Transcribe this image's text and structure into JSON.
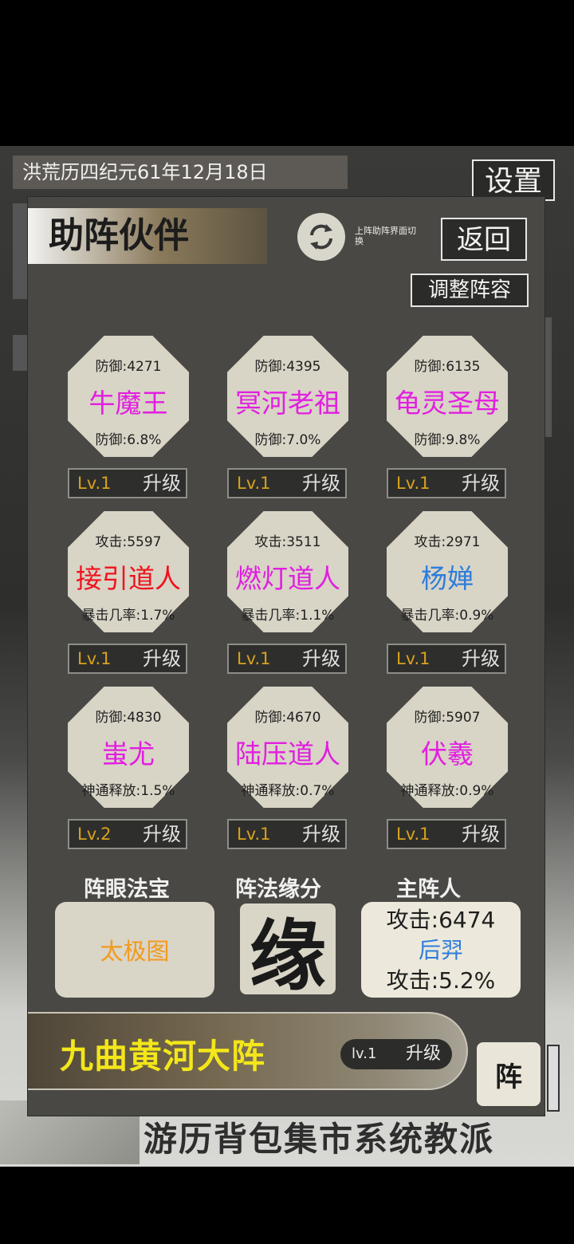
{
  "background": {
    "date": "洪荒历四纪元61年12月18日",
    "settings_label": "设置",
    "nav": "游历背包集市系统教派"
  },
  "panel": {
    "title": "助阵伙伴",
    "refresh_note": "上阵助阵界面切换",
    "back_label": "返回",
    "adjust_label": "调整阵容"
  },
  "partners": [
    {
      "stat1": "防御:4271",
      "name": "牛魔王",
      "name_color": "#e21ee0",
      "stat2": "防御:6.8%",
      "level": "Lv.1",
      "upgrade": "升级"
    },
    {
      "stat1": "防御:4395",
      "name": "冥河老祖",
      "name_color": "#e21ee0",
      "stat2": "防御:7.0%",
      "level": "Lv.1",
      "upgrade": "升级"
    },
    {
      "stat1": "防御:6135",
      "name": "龟灵圣母",
      "name_color": "#e21ee0",
      "stat2": "防御:9.8%",
      "level": "Lv.1",
      "upgrade": "升级"
    },
    {
      "stat1": "攻击:5597",
      "name": "接引道人",
      "name_color": "#f0121c",
      "stat2": "暴击几率:1.7%",
      "level": "Lv.1",
      "upgrade": "升级"
    },
    {
      "stat1": "攻击:3511",
      "name": "燃灯道人",
      "name_color": "#e21ee0",
      "stat2": "暴击几率:1.1%",
      "level": "Lv.1",
      "upgrade": "升级"
    },
    {
      "stat1": "攻击:2971",
      "name": "杨婵",
      "name_color": "#2e7ddb",
      "stat2": "暴击几率:0.9%",
      "level": "Lv.1",
      "upgrade": "升级"
    },
    {
      "stat1": "防御:4830",
      "name": "蚩尤",
      "name_color": "#e21ee0",
      "stat2": "神通释放:1.5%",
      "level": "Lv.2",
      "upgrade": "升级"
    },
    {
      "stat1": "防御:4670",
      "name": "陆压道人",
      "name_color": "#e21ee0",
      "stat2": "神通释放:0.7%",
      "level": "Lv.1",
      "upgrade": "升级"
    },
    {
      "stat1": "防御:5907",
      "name": "伏羲",
      "name_color": "#e21ee0",
      "stat2": "神通释放:0.9%",
      "level": "Lv.1",
      "upgrade": "升级"
    }
  ],
  "sections": {
    "treasure_label": "阵眼法宝",
    "treasure_value": "太极图",
    "fate_label": "阵法缘分",
    "fate_glyph": "缘",
    "main_label": "主阵人",
    "main_stat1": "攻击:6474",
    "main_name": "后羿",
    "main_stat2": "攻击:5.2%"
  },
  "formation": {
    "name": "九曲黄河大阵",
    "level": "lv.1",
    "upgrade": "升级",
    "zhen_label": "阵"
  }
}
